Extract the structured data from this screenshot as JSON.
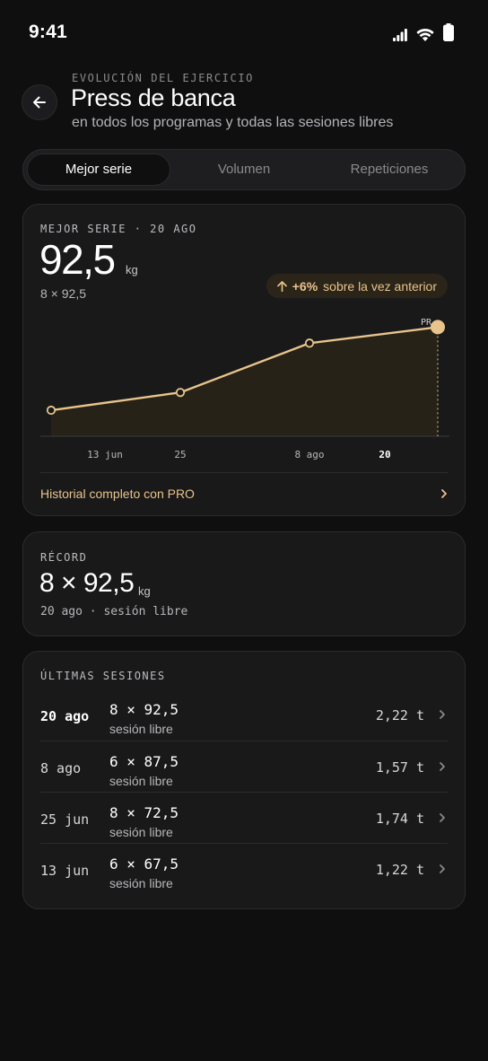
{
  "status": {
    "time": "9:41"
  },
  "header": {
    "eyebrow": "EVOLUCIÓN DEL EJERCICIO",
    "title": "Press de banca",
    "subtitle": "en todos los programas y todas las sesiones libres"
  },
  "tabs": [
    {
      "label": "Mejor serie",
      "active": true
    },
    {
      "label": "Volumen",
      "active": false
    },
    {
      "label": "Repeticiones",
      "active": false
    }
  ],
  "best_set_card": {
    "eyebrow": "MEJOR SERIE · 20 AGO",
    "value": "92,5",
    "unit": "kg",
    "detail": "8 × 92,5",
    "delta_pct": "+6%",
    "delta_text": "sobre la vez anterior",
    "pro_link": "Historial completo con PRO"
  },
  "chart_data": {
    "type": "line",
    "x": [
      "13 jun",
      "25",
      "8 ago",
      "20"
    ],
    "y": [
      72.5,
      75.6,
      84.2,
      87.0
    ],
    "pr_label": "PR",
    "highlight_index": 3
  },
  "record_card": {
    "eyebrow": "RÉCORD",
    "value": "8 × 92,5",
    "unit": "kg",
    "meta": "20 ago · sesión libre"
  },
  "sessions_card": {
    "eyebrow": "ÚLTIMAS SESIONES",
    "rows": [
      {
        "date": "20 ago",
        "sets": "8 × 92,5",
        "type": "sesión libre",
        "volume": "2,22 t"
      },
      {
        "date": "8 ago",
        "sets": "6 × 87,5",
        "type": "sesión libre",
        "volume": "1,57 t"
      },
      {
        "date": "25 jun",
        "sets": "8 × 72,5",
        "type": "sesión libre",
        "volume": "1,74 t"
      },
      {
        "date": "13 jun",
        "sets": "6 × 67,5",
        "type": "sesión libre",
        "volume": "1,22 t"
      }
    ]
  },
  "colors": {
    "accent": "#e8c48c",
    "background": "#0f0f10",
    "card": "#19191a"
  }
}
